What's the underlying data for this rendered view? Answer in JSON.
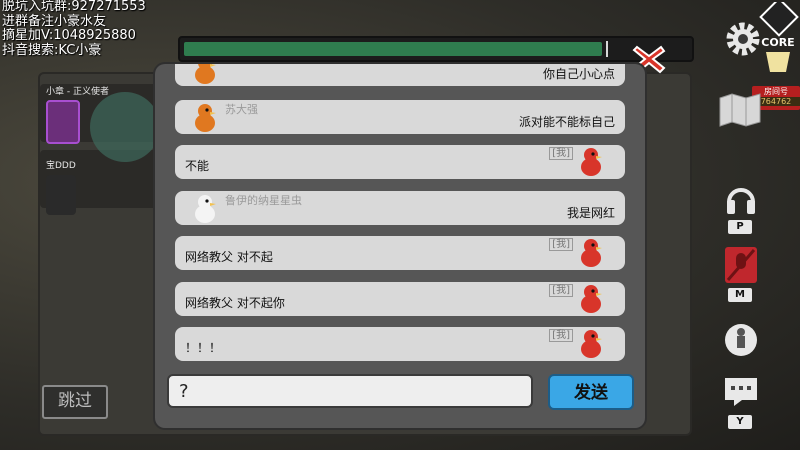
{
  "stream_overlay": {
    "lines": [
      "脱坑入坑群:927271553",
      "进群备注小豪水友",
      "摘星加V:1048925880",
      "抖音搜索:KC小豪"
    ]
  },
  "players": [
    {
      "name": "小章 - 正义使者"
    },
    {
      "name": "宝DDD"
    }
  ],
  "progress": {
    "fill_fraction": 0.83
  },
  "room": {
    "label": "房间号",
    "number": "764762"
  },
  "hotkeys": {
    "voice": "P",
    "mic": "M",
    "chat": "Y"
  },
  "skip_label": "跳过",
  "chat": {
    "messages": [
      {
        "side": "other",
        "sender": "",
        "text": "你自己小心点",
        "avatar_color": "#e07820"
      },
      {
        "side": "other",
        "sender": "苏大强",
        "text": "派对能不能标自己",
        "avatar_color": "#e07820"
      },
      {
        "side": "mine",
        "tag": "[我]",
        "text": "不能",
        "avatar_color": "#d8352a"
      },
      {
        "side": "other",
        "sender": "鲁伊的纳星星虫",
        "text": "我是网红",
        "avatar_color": "#f4f4f4"
      },
      {
        "side": "mine",
        "tag": "[我]",
        "text": "网络教父 对不起",
        "avatar_color": "#d8352a"
      },
      {
        "side": "mine",
        "tag": "[我]",
        "text": "网络教父 对不起你",
        "avatar_color": "#d8352a"
      },
      {
        "side": "mine",
        "tag": "[我]",
        "text": "！！！",
        "avatar_color": "#d8352a"
      }
    ],
    "input_value": "?",
    "send_label": "发送"
  },
  "colors": {
    "send_button": "#3aa7e6",
    "progress_fill": "#2f7d4f",
    "close_red": "#d8352a"
  },
  "icons": [
    "close-icon",
    "gear-icon",
    "map-icon",
    "headphones-icon",
    "mic-muted-icon",
    "chess-icon",
    "chat-icon",
    "core-logo"
  ]
}
